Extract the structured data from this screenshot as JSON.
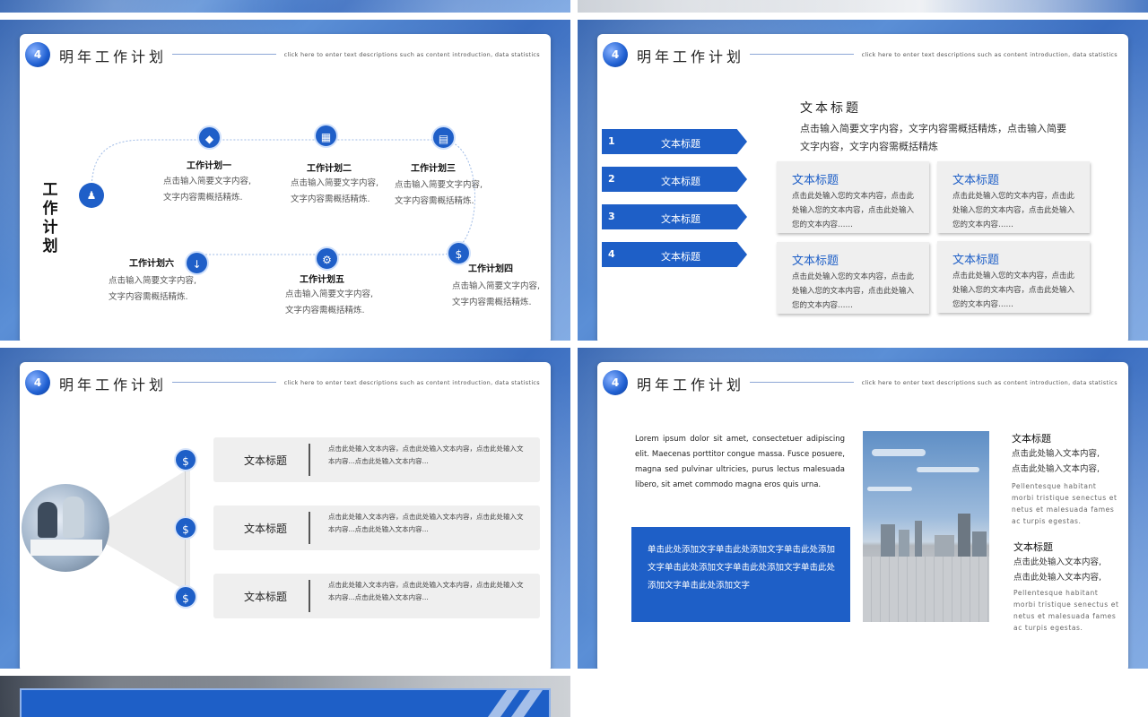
{
  "header": {
    "badge": "4",
    "title": "明年工作计划",
    "desc": "click here to enter text descriptions such as content introduction, data statistics"
  },
  "slide1": {
    "vertical_title": "工作计划",
    "plans": [
      {
        "title": "工作计划一",
        "line1": "点击输入简要文字内容,",
        "line2": "文字内容需概括精炼."
      },
      {
        "title": "工作计划二",
        "line1": "点击输入简要文字内容,",
        "line2": "文字内容需概括精炼."
      },
      {
        "title": "工作计划三",
        "line1": "点击输入简要文字内容,",
        "line2": "文字内容需概括精炼."
      },
      {
        "title": "工作计划四",
        "line1": "点击输入简要文字内容,",
        "line2": "文字内容需概括精炼."
      },
      {
        "title": "工作计划五",
        "line1": "点击输入简要文字内容,",
        "line2": "文字内容需概括精炼."
      },
      {
        "title": "工作计划六",
        "line1": "点击输入简要文字内容,",
        "line2": "文字内容需概括精炼."
      }
    ]
  },
  "slide2": {
    "arrows": [
      {
        "num": "1",
        "label": "文本标题"
      },
      {
        "num": "2",
        "label": "文本标题"
      },
      {
        "num": "3",
        "label": "文本标题"
      },
      {
        "num": "4",
        "label": "文本标题"
      }
    ],
    "heading": "文本标题",
    "paragraph": "点击输入简要文字内容，文字内容需概括精炼，点击输入简要文字内容，文字内容需概括精炼",
    "boxes": [
      {
        "title": "文本标题",
        "body": "点击此处输入您的文本内容，点击此处输入您的文本内容，点击此处输入您的文本内容……"
      },
      {
        "title": "文本标题",
        "body": "点击此处输入您的文本内容，点击此处输入您的文本内容，点击此处输入您的文本内容……"
      },
      {
        "title": "文本标题",
        "body": "点击此处输入您的文本内容，点击此处输入您的文本内容，点击此处输入您的文本内容……"
      },
      {
        "title": "文本标题",
        "body": "点击此处输入您的文本内容，点击此处输入您的文本内容，点击此处输入您的文本内容……"
      }
    ]
  },
  "slide3": {
    "rows": [
      {
        "title": "文本标题",
        "body": "点击此处输入文本内容，点击此处输入文本内容，点击此处输入文本内容...点击此处输入文本内容..."
      },
      {
        "title": "文本标题",
        "body": "点击此处输入文本内容，点击此处输入文本内容，点击此处输入文本内容...点击此处输入文本内容..."
      },
      {
        "title": "文本标题",
        "body": "点击此处输入文本内容，点击此处输入文本内容，点击此处输入文本内容...点击此处输入文本内容..."
      }
    ]
  },
  "slide4": {
    "lorem": "Lorem ipsum dolor sit amet, consectetuer adipiscing elit. Maecenas porttitor congue massa. Fusce posuere, magna sed pulvinar ultricies, purus lectus malesuada libero, sit amet commodo magna eros quis urna.",
    "blue_text": "单击此处添加文字单击此处添加文字单击此处添加文字单击此处添加文字单击此处添加文字单击此处添加文字单击此处添加文字",
    "side": [
      {
        "title": "文本标题",
        "cn1": "点击此处输入文本内容,",
        "cn2": "点击此处输入文本内容,",
        "en1": "Pellentesque habitant",
        "en2": "morbi tristique senectus et",
        "en3": "netus et malesuada fames",
        "en4": "ac turpis egestas."
      },
      {
        "title": "文本标题",
        "cn1": "点击此处输入文本内容,",
        "cn2": "点击此处输入文本内容,",
        "en1": "Pellentesque habitant",
        "en2": "morbi tristique senectus et",
        "en3": "netus et malesuada fames",
        "en4": "ac turpis egestas."
      }
    ]
  }
}
